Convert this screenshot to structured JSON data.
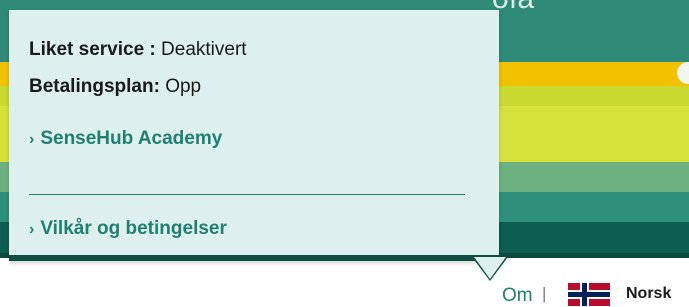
{
  "popover": {
    "liked_service_label": "Liket service",
    "liked_service_sep": ":",
    "liked_service_value": "Deaktivert",
    "payment_plan_label": "Betalingsplan:",
    "payment_plan_value": "Opp",
    "link_academy": "SenseHub Academy",
    "link_terms": "Vilkår og betingelser",
    "chevron": "›"
  },
  "footer": {
    "about": "Om",
    "separator": "|",
    "language": "Norsk",
    "flag_icon": "norway-flag-icon"
  },
  "colors": {
    "accent": "#1f7f71",
    "popover_bg": "#def0ee",
    "dark_green": "#0f4c43"
  }
}
